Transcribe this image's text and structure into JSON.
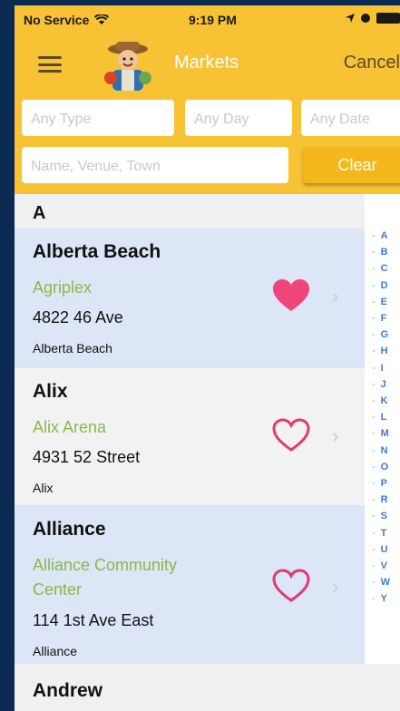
{
  "status_bar": {
    "carrier": "No Service",
    "time": "9:19 PM"
  },
  "nav": {
    "title": "Markets",
    "cancel_label": "Cancel"
  },
  "filters": {
    "type_placeholder": "Any Type",
    "day_placeholder": "Any Day",
    "date_placeholder": "Any Date",
    "search_placeholder": "Name, Venue, Town",
    "clear_label": "Clear"
  },
  "section": {
    "letter": "A"
  },
  "markets": [
    {
      "name": "Alberta Beach",
      "venue": "Agriplex",
      "address": "4822 46 Ave",
      "town": "Alberta Beach",
      "favorite": true
    },
    {
      "name": "Alix",
      "venue": "Alix Arena",
      "address": "4931 52 Street",
      "town": "Alix",
      "favorite": false
    },
    {
      "name": "Alliance",
      "venue": "Alliance Community Center",
      "address": "114 1st Ave East",
      "town": "Alliance",
      "favorite": false
    },
    {
      "name": "Andrew"
    }
  ],
  "index_letters": [
    "A",
    "B",
    "C",
    "D",
    "E",
    "F",
    "G",
    "H",
    "I",
    "J",
    "K",
    "L",
    "M",
    "N",
    "O",
    "P",
    "R",
    "S",
    "T",
    "U",
    "V",
    "W",
    "Y"
  ],
  "colors": {
    "brand_yellow": "#f7c233",
    "favorite_pink": "#f0457a",
    "venue_green": "#8cb84a",
    "row_highlight": "#dce6f6",
    "index_blue": "#3b7bd8"
  }
}
